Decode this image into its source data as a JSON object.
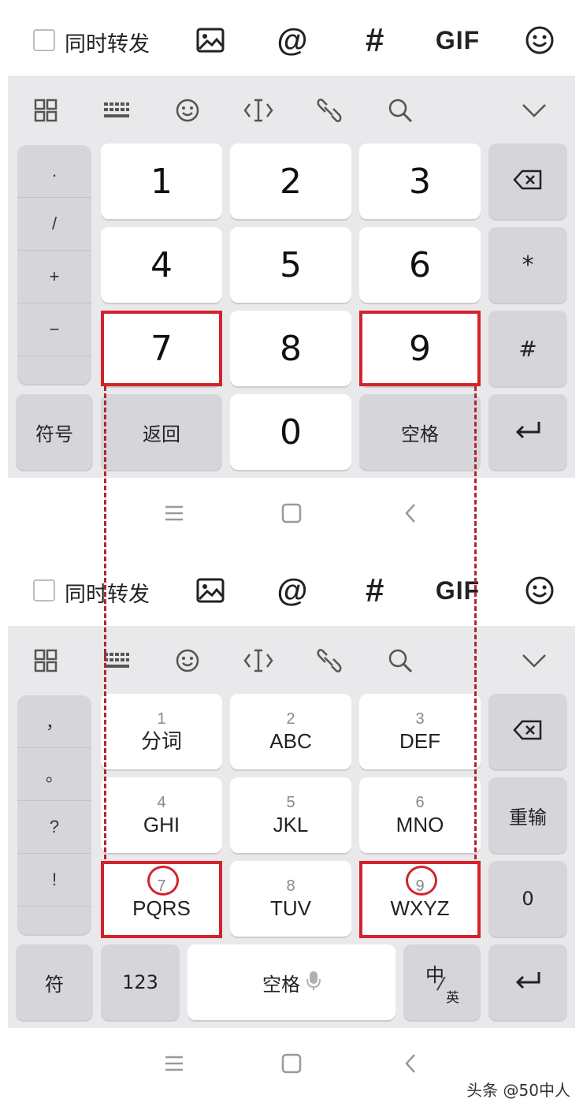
{
  "compose_bar": {
    "forward_label": "同时转发",
    "icons": [
      "image-icon",
      "at-icon",
      "hash-icon",
      "gif-icon",
      "emoji-icon"
    ],
    "at_glyph": "@",
    "hash_glyph": "#",
    "gif_label": "GIF"
  },
  "toolbar": {
    "icons": [
      "apps-grid-icon",
      "keyboard-icon",
      "emoji-icon",
      "cursor-move-icon",
      "clipboard-link-icon",
      "search-icon",
      "collapse-chevron-icon"
    ]
  },
  "number_keyboard": {
    "punct": [
      ".",
      "/",
      "+",
      "−"
    ],
    "keys": [
      "1",
      "2",
      "3",
      "4",
      "5",
      "6",
      "7",
      "8",
      "9",
      "0"
    ],
    "delete_icon": "backspace-icon",
    "star": "*",
    "hash": "#",
    "symbols": "符号",
    "back": "返回",
    "space": "空格",
    "enter_icon": "enter-icon"
  },
  "pinyin_keyboard": {
    "punct": [
      "，",
      "。",
      "?",
      "!"
    ],
    "keys": [
      {
        "num": "1",
        "letters": "分词"
      },
      {
        "num": "2",
        "letters": "ABC"
      },
      {
        "num": "3",
        "letters": "DEF"
      },
      {
        "num": "4",
        "letters": "GHI"
      },
      {
        "num": "5",
        "letters": "JKL"
      },
      {
        "num": "6",
        "letters": "MNO"
      },
      {
        "num": "7",
        "letters": "PQRS"
      },
      {
        "num": "8",
        "letters": "TUV"
      },
      {
        "num": "9",
        "letters": "WXYZ"
      }
    ],
    "reenter": "重输",
    "zero": "0",
    "symbols": "符",
    "numbers": "123",
    "space": "空格",
    "lang_main": "中",
    "lang_sub": "英"
  },
  "nav": {
    "icons": [
      "menu-icon",
      "home-icon",
      "back-icon"
    ]
  },
  "watermark": "头条 @50中人",
  "colors": {
    "highlight": "#d3232a",
    "keyboard_bg": "#e9e9ec",
    "gray_key": "#d6d6da"
  }
}
